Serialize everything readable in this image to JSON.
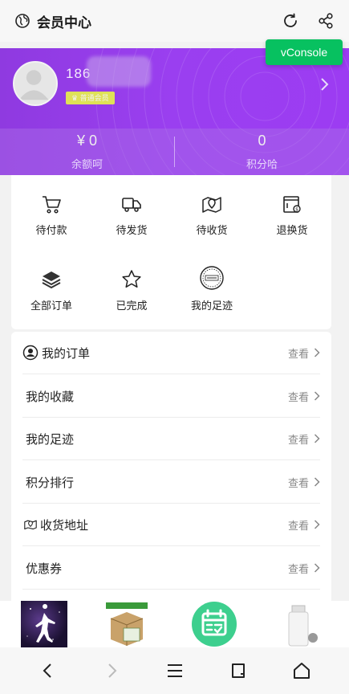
{
  "topbar": {
    "title": "会员中心",
    "icons": [
      "globe-icon",
      "refresh-icon",
      "share-icon"
    ]
  },
  "vconsole": {
    "label": "vConsole",
    "color": "#07c160"
  },
  "profile": {
    "phone": "186",
    "level": "普通会员",
    "balance_value": "¥ 0",
    "balance_label": "余额呵",
    "points_value": "0",
    "points_label": "积分哈"
  },
  "orders": [
    {
      "label": "待付款",
      "icon": "cart-icon"
    },
    {
      "label": "待发货",
      "icon": "truck-icon"
    },
    {
      "label": "待收货",
      "icon": "map-pin-icon"
    },
    {
      "label": "退换货",
      "icon": "return-icon"
    },
    {
      "label": "全部订单",
      "icon": "layers-icon"
    },
    {
      "label": "已完成",
      "icon": "star-icon"
    },
    {
      "label": "我的足迹",
      "icon": "footprint-stamp-icon"
    }
  ],
  "list": [
    {
      "label": "我的订单",
      "action": "查看",
      "icon": "person-circle-icon"
    },
    {
      "label": "我的收藏",
      "action": "查看"
    },
    {
      "label": "我的足迹",
      "action": "查看"
    },
    {
      "label": "积分排行",
      "action": "查看"
    },
    {
      "label": "收货地址",
      "action": "查看",
      "icon": "map-icon"
    },
    {
      "label": "优惠券",
      "action": "查看"
    }
  ],
  "colors": {
    "accent": "#9a3ff0",
    "fab": "#3dcf8e"
  }
}
